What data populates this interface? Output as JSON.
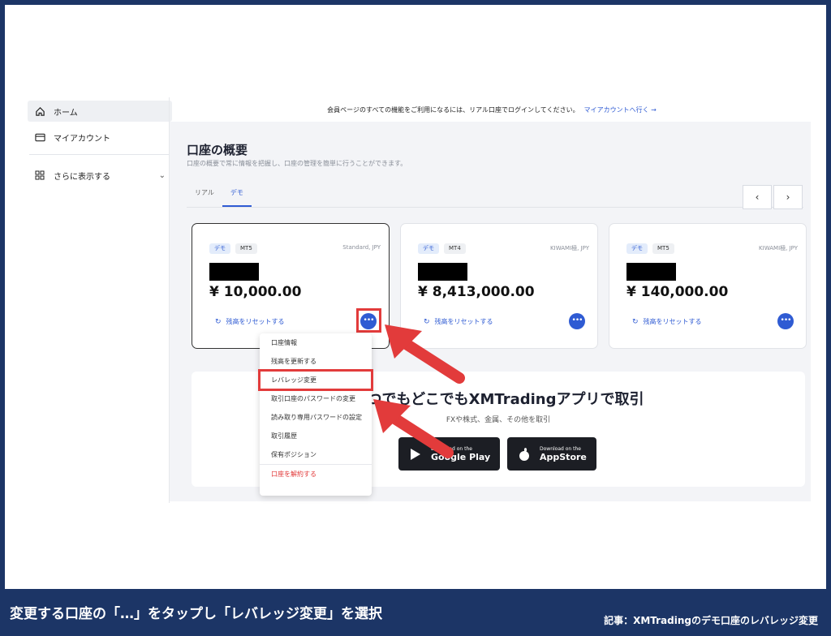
{
  "sidebar": {
    "items": [
      {
        "label": "ホーム",
        "icon": "home-icon",
        "active": true
      },
      {
        "label": "マイアカウント",
        "icon": "card-icon"
      }
    ],
    "more": {
      "label": "さらに表示する",
      "icon": "grid-icon"
    }
  },
  "banner": {
    "text": "会員ページのすべての機能をご利用になるには、リアル口座でログインしてください。",
    "link": "マイアカウントへ行く →"
  },
  "overview": {
    "title": "口座の概要",
    "subtitle": "口座の概要で常に情報を把握し、口座の管理を簡単に行うことができます。",
    "tabs": [
      {
        "label": "リアル",
        "active": false
      },
      {
        "label": "デモ",
        "active": true
      }
    ],
    "nav": {
      "prev": "‹",
      "next": "›"
    }
  },
  "accounts": [
    {
      "badge": "デモ",
      "platform": "MT5",
      "type": "Standard, JPY",
      "balance": "¥ 10,000.00",
      "reset": "残高をリセットする",
      "more": "•••",
      "selected": true
    },
    {
      "badge": "デモ",
      "platform": "MT4",
      "type": "KIWAMI極, JPY",
      "balance": "¥ 8,413,000.00",
      "reset": "残高をリセットする",
      "more": "•••"
    },
    {
      "badge": "デモ",
      "platform": "MT5",
      "type": "KIWAMI極, JPY",
      "balance": "¥ 140,000.00",
      "reset": "残高をリセットする",
      "more": "•••"
    }
  ],
  "promo": {
    "title": "いつでもどこでもXMTradingアプリで取引",
    "subtitle": "FXや株式、金属、その他を取引",
    "google": {
      "small": "Download on the",
      "big": "Google Play"
    },
    "apple": {
      "small": "Download on the",
      "big": "AppStore"
    }
  },
  "menu": {
    "items": [
      {
        "label": "口座情報"
      },
      {
        "label": "残高を更新する"
      },
      {
        "label": "レバレッジ変更",
        "highlighted": true
      },
      {
        "label": "取引口座のパスワードの変更"
      },
      {
        "label": "読み取り専用パスワードの設定"
      },
      {
        "label": "取引履歴"
      },
      {
        "label": "保有ポジション"
      },
      {
        "label": "口座を解約する",
        "danger": true
      }
    ]
  },
  "caption": {
    "main": "変更する口座の「…」をタップし「レバレッジ変更」を選択",
    "sub": "記事：XMTradingのデモ口座のレバレッジ変更"
  },
  "colors": {
    "accent": "#2f5bd3",
    "annotation": "#e23b3b",
    "caption_bg": "#1c3566"
  }
}
